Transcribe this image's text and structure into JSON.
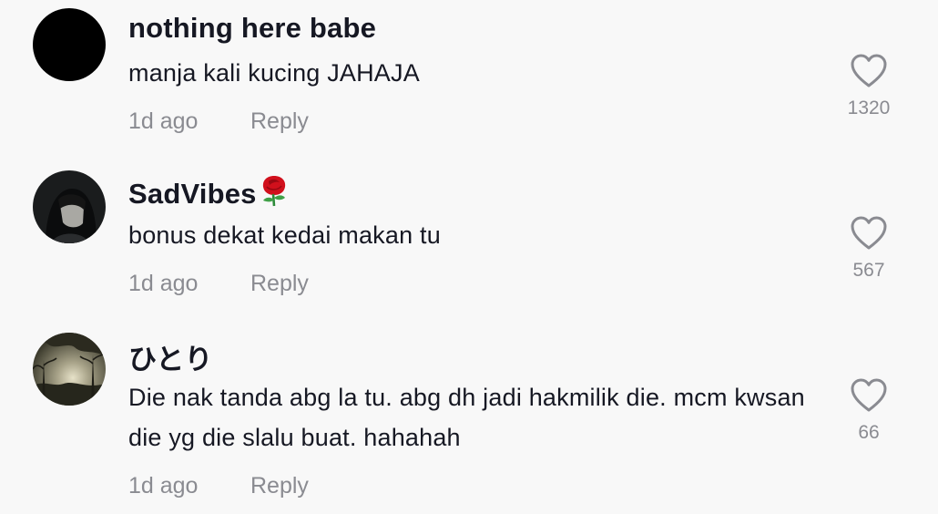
{
  "comments": [
    {
      "username": "nothing here babe",
      "username_emoji": "",
      "text": "manja kali kucing JAHAJA",
      "time": "1d ago",
      "reply_label": "Reply",
      "likes": "1320"
    },
    {
      "username": "SadVibes",
      "username_emoji": "rose-emoji",
      "text": "bonus dekat kedai makan tu",
      "time": "1d ago",
      "reply_label": "Reply",
      "likes": "567"
    },
    {
      "username": "ひとり",
      "username_emoji": "",
      "text": "Die nak tanda abg la tu. abg dh jadi hakmilik die. mcm kwsan die yg die slalu buat. hahahah",
      "time": "1d ago",
      "reply_label": "Reply",
      "likes": "66"
    }
  ],
  "colors": {
    "background": "#f8f8f8",
    "primary_text": "#161823",
    "secondary_text": "#8a8b91",
    "heart_outline": "#8a8b91"
  },
  "icons": {
    "like": "heart-outline-icon"
  }
}
